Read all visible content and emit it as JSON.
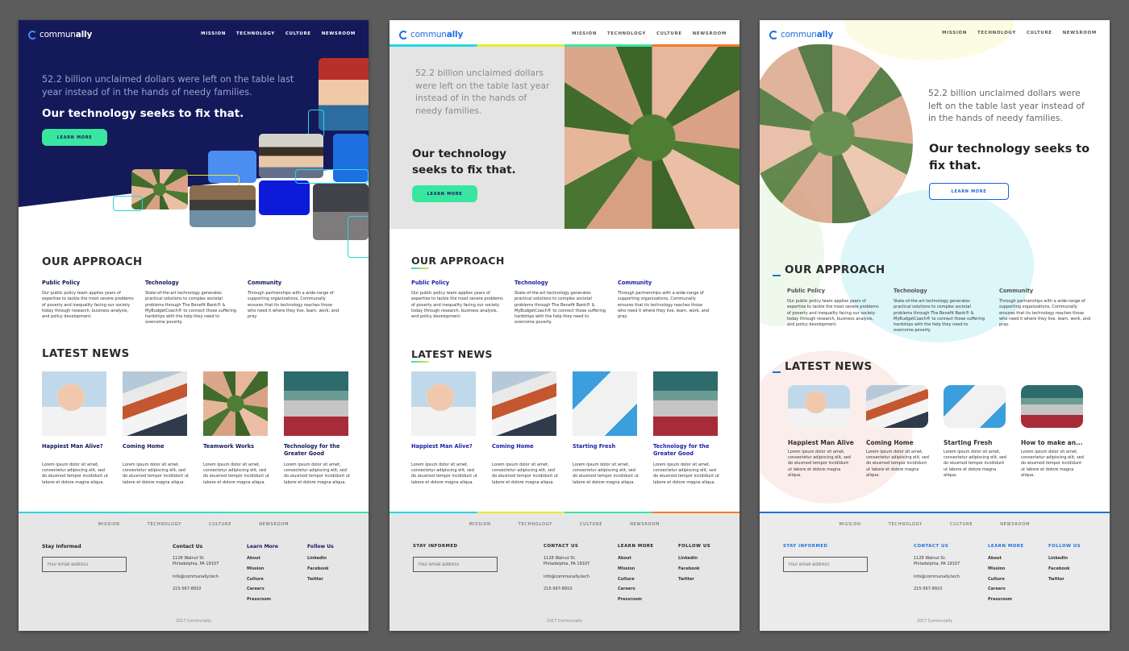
{
  "brand": {
    "prefix": "commun",
    "suffix": "ally"
  },
  "nav": [
    "MISSION",
    "TECHNOLOGY",
    "CULTURE",
    "NEWSROOM"
  ],
  "hero": {
    "stat": "52.2 billion unclaimed dollars were left on the table last year instead of in the hands of needy families.",
    "tagline": "Our technology seeks to fix that.",
    "cta": "LEARN MORE"
  },
  "approach": {
    "title": "OUR APPROACH",
    "columns": [
      {
        "title": "Public Policy",
        "text": "Our public policy team applies years of expertise to tackle the most severe problems of poverty and inequality facing our society today through research, business analysis, and policy development."
      },
      {
        "title": "Technology",
        "text": "State-of-the-art technology generates practical solutions to complex societal problems through The Benefit Bank® & MyBudgetCoach® to connect those suffering hardships with the help they need to overcome poverty."
      },
      {
        "title": "Community",
        "text": "Through partnerships with a wide-range of supporting organizations, Communally ensures that its technology reaches those who need it where they live, learn, work, and pray."
      }
    ]
  },
  "news": {
    "title": "LATEST NEWS",
    "lorem": "Lorem ipsum dolor sit amet, consectetur adipiscing elit, sed do eiusmod tempor incididunt ut labore et dolore magna aliqua.",
    "v1": [
      "Happiest Man Alive?",
      "Coming Home",
      "Teamwork Works",
      "Technology for the Greater Good"
    ],
    "v2": [
      "Happiest Man Alive?",
      "Coming Home",
      "Starting Fresh",
      "Technology for the Greater Good"
    ],
    "v3": [
      "Happiest Man Alive",
      "Coming Home",
      "Starting Fresh",
      "How to make an..."
    ]
  },
  "footer": {
    "stay_informed": "Stay Informed",
    "stay_informed_caps": "STAY INFORMED",
    "email_placeholder": "Your email address",
    "contact": {
      "title": "Contact Us",
      "title_caps": "CONTACT US",
      "address": "1128 Walnut St.\nPhiladelphia, PA 19107",
      "email": "info@communally.tech",
      "phone": "215-567-8910"
    },
    "learn": {
      "title": "Learn More",
      "title_caps": "LEARN MORE",
      "links": [
        "About",
        "Mission",
        "Culture",
        "Careers",
        "Pressroom"
      ]
    },
    "follow": {
      "title": "Follow Us",
      "title_caps": "FOLLOW US",
      "links": [
        "LinkedIn",
        "Facebook",
        "Twitter"
      ]
    },
    "copyright": "2017 Communally"
  },
  "colors": {
    "navy": "#14195a",
    "mint": "#39e6a0",
    "blue": "#1e6fe0",
    "link_blue": "#1d22a8",
    "footer_bg": "#e6e6e6"
  }
}
